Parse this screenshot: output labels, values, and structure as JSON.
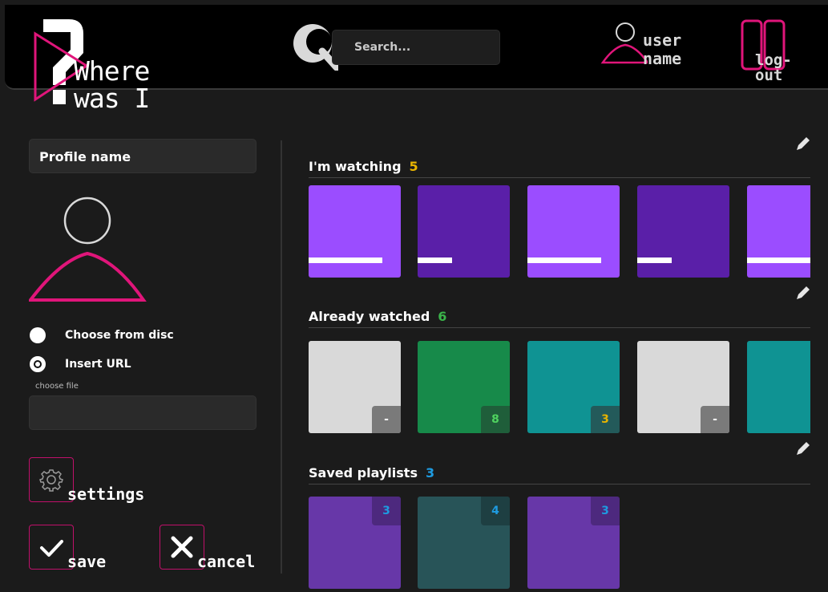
{
  "header": {
    "logo": {
      "line1": "Where",
      "line2": "was I",
      "mark": "?"
    },
    "search": {
      "placeholder": "Search..."
    },
    "user": {
      "line1": "user",
      "line2": "name"
    },
    "logout_label": "log-out"
  },
  "profile": {
    "name_field": "Profile name",
    "options": [
      {
        "label": "Choose from disc",
        "selected": false
      },
      {
        "label": "Insert URL",
        "selected": true
      }
    ],
    "file_label": "choose file",
    "file_value": "",
    "settings_label": "settings",
    "save_label": "save",
    "cancel_label": "cancel"
  },
  "sections": [
    {
      "title": "I'm watching",
      "count": "5",
      "count_color": "#e8b400",
      "tiles": [
        {
          "color": "#9b4dff",
          "progress": 0.8
        },
        {
          "color": "#5a1fa8",
          "progress": 0.37
        },
        {
          "color": "#9b4dff",
          "progress": 0.8
        },
        {
          "color": "#5a1fa8",
          "progress": 0.37
        },
        {
          "color": "#9b4dff",
          "progress": 0.85
        }
      ]
    },
    {
      "title": "Already watched",
      "count": "6",
      "count_color": "#3bb34a",
      "tiles": [
        {
          "color": "#d9d9d9",
          "badge": "-",
          "badge_color": "#ffffff",
          "badge_bg": "#7a7a7a"
        },
        {
          "color": "#178a4a",
          "badge": "8",
          "badge_color": "#4fd25f",
          "badge_bg": "#1f5e3a"
        },
        {
          "color": "#0f9393",
          "badge": "3",
          "badge_color": "#e8b400",
          "badge_bg": "#235a5a"
        },
        {
          "color": "#d9d9d9",
          "badge": "-",
          "badge_color": "#ffffff",
          "badge_bg": "#7a7a7a"
        },
        {
          "color": "#0f9393"
        }
      ]
    },
    {
      "title": "Saved playlists",
      "count": "3",
      "count_color": "#1e9be0",
      "tiles": [
        {
          "color": "#6737a8",
          "badge": "3",
          "badge_color": "#1e9be0"
        },
        {
          "color": "#285458",
          "badge": "4",
          "badge_color": "#1e9be0"
        },
        {
          "color": "#6737a8",
          "badge": "3",
          "badge_color": "#1e9be0"
        }
      ]
    }
  ],
  "colors": {
    "accent": "#e0157a",
    "background": "#1b1b1b",
    "header": "#000000"
  }
}
